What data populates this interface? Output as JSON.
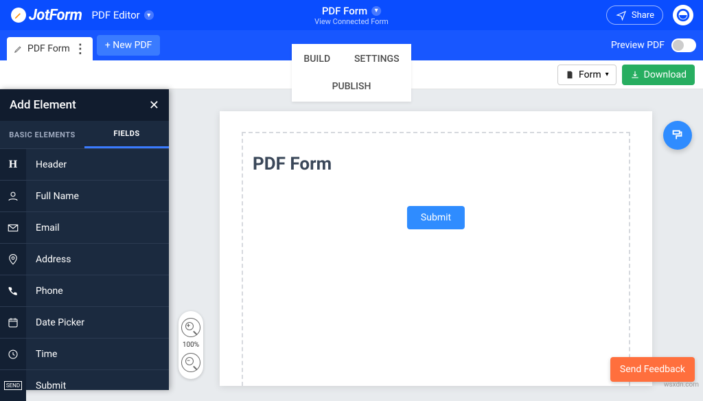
{
  "header": {
    "brand": "JotForm",
    "product": "PDF Editor",
    "doc_title": "PDF Form",
    "subtitle": "View Connected Form",
    "share": "Share"
  },
  "secondbar": {
    "tab_label": "PDF Form",
    "new_pdf": "+ New PDF",
    "center_tabs": [
      "BUILD",
      "SETTINGS",
      "PUBLISH"
    ],
    "preview_label": "Preview PDF"
  },
  "toolbar": {
    "form_dd": "Form",
    "download": "Download"
  },
  "side_panel": {
    "title": "Add Element",
    "tabs": [
      "BASIC ELEMENTS",
      "FIELDS"
    ],
    "items": [
      {
        "icon": "H",
        "label": "Header"
      },
      {
        "icon": "user",
        "label": "Full Name"
      },
      {
        "icon": "mail",
        "label": "Email"
      },
      {
        "icon": "pin",
        "label": "Address"
      },
      {
        "icon": "phone",
        "label": "Phone"
      },
      {
        "icon": "cal",
        "label": "Date Picker"
      },
      {
        "icon": "clock",
        "label": "Time"
      },
      {
        "icon": "send",
        "label": "Submit"
      }
    ]
  },
  "zoom": {
    "pct": "100%"
  },
  "page": {
    "title": "PDF Form",
    "submit": "Submit"
  },
  "feedback": "Send Feedback",
  "watermark": "wsxdn.com"
}
